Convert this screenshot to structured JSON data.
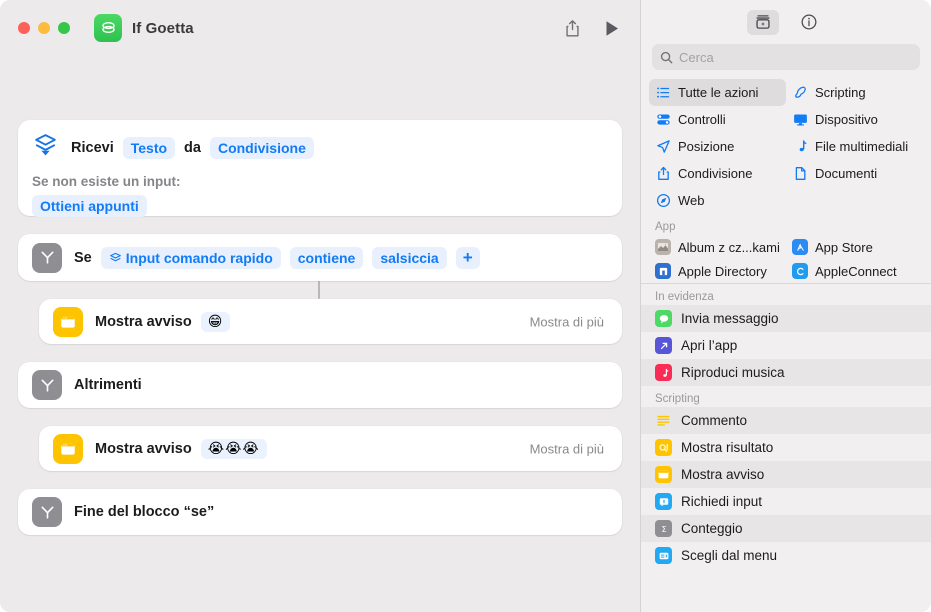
{
  "window": {
    "title": "If Goetta",
    "app_icon": "shortcuts-icon",
    "traffic_lights": [
      "close",
      "minimize",
      "zoom"
    ],
    "share_icon": "share-icon",
    "run_icon": "play-icon"
  },
  "editor": {
    "actions": [
      {
        "id": "receive",
        "icon": "receive-input-icon",
        "label": "Ricevi",
        "pill_type": "Testo",
        "connector": "da",
        "pill_source": "Condivisione",
        "sub_label": "Se non esiste un input:",
        "sub_pill": "Ottieni appunti"
      },
      {
        "id": "if",
        "icon": "branch-icon",
        "label": "Se",
        "pill_variable": "Input comando rapido",
        "variable_icon": "magic-variable-icon",
        "pill_operator": "contiene",
        "pill_value": "salsiccia",
        "add_label": "+"
      },
      {
        "id": "show-alert-1",
        "icon": "show-alert-icon",
        "label": "Mostra avviso",
        "emoji": "😁",
        "show_more": "Mostra di più"
      },
      {
        "id": "otherwise",
        "icon": "branch-icon",
        "label": "Altrimenti"
      },
      {
        "id": "show-alert-2",
        "icon": "show-alert-icon",
        "label": "Mostra avviso",
        "emoji": "😭😭😭",
        "show_more": "Mostra di più"
      },
      {
        "id": "end-if",
        "icon": "branch-icon",
        "label": "Fine del blocco “se”"
      }
    ]
  },
  "library": {
    "toolbar": {
      "action_library_icon": "action-library-icon",
      "info_icon": "info-icon"
    },
    "search": {
      "placeholder": "Cerca",
      "icon": "search-icon",
      "value": ""
    },
    "categories": [
      {
        "label": "Tutte le azioni",
        "icon": "list-icon",
        "selected": true
      },
      {
        "label": "Scripting",
        "icon": "scripting-icon",
        "selected": false
      },
      {
        "label": "Controlli",
        "icon": "controls-icon",
        "selected": false
      },
      {
        "label": "Dispositivo",
        "icon": "device-icon",
        "selected": false
      },
      {
        "label": "Posizione",
        "icon": "location-icon",
        "selected": false
      },
      {
        "label": "File multimediali",
        "icon": "media-icon",
        "selected": false
      },
      {
        "label": "Condivisione",
        "icon": "share-icon",
        "selected": false
      },
      {
        "label": "Documenti",
        "icon": "documents-icon",
        "selected": false
      },
      {
        "label": "Web",
        "icon": "web-icon",
        "selected": false
      }
    ],
    "sections": [
      {
        "title": "App",
        "layout": "grid",
        "items": [
          {
            "label": "Album z cz...kami",
            "icon": "album-app-icon",
            "color": "#b9b3ab"
          },
          {
            "label": "App Store",
            "icon": "app-store-icon",
            "color": "#2b8bf2"
          },
          {
            "label": "Apple Directory",
            "icon": "apple-directory-icon",
            "color": "#2f6fd0"
          },
          {
            "label": "AppleConnect",
            "icon": "apple-connect-icon",
            "color": "#1f9cf0"
          }
        ]
      },
      {
        "title": "In evidenza",
        "layout": "list",
        "items": [
          {
            "label": "Invia messaggio",
            "icon": "messages-icon",
            "color": "#4cd964"
          },
          {
            "label": "Apri l’app",
            "icon": "open-app-icon",
            "color": "#5856d6"
          },
          {
            "label": "Riproduci musica",
            "icon": "music-icon",
            "color": "#fa2c55"
          }
        ]
      },
      {
        "title": "Scripting",
        "layout": "list",
        "items": [
          {
            "label": "Commento",
            "icon": "comment-icon",
            "color": "#ffc400"
          },
          {
            "label": "Mostra risultato",
            "icon": "show-result-icon",
            "color": "#ffc400"
          },
          {
            "label": "Mostra avviso",
            "icon": "show-alert-icon",
            "color": "#ffc400"
          },
          {
            "label": "Richiedi input",
            "icon": "ask-input-icon",
            "color": "#23a8f2"
          },
          {
            "label": "Conteggio",
            "icon": "count-icon",
            "color": "#8e8e93"
          },
          {
            "label": "Scegli dal menu",
            "icon": "choose-menu-icon",
            "color": "#23a8f2"
          }
        ]
      }
    ]
  },
  "colors": {
    "accent_blue": "#127bf6",
    "pill_bg": "#e8f0fe",
    "window_bg": "#eceaea",
    "card_bg": "#ffffff",
    "library_bg": "#f1efef",
    "yellow": "#ffc400",
    "gray_icon": "#8e8e93"
  }
}
